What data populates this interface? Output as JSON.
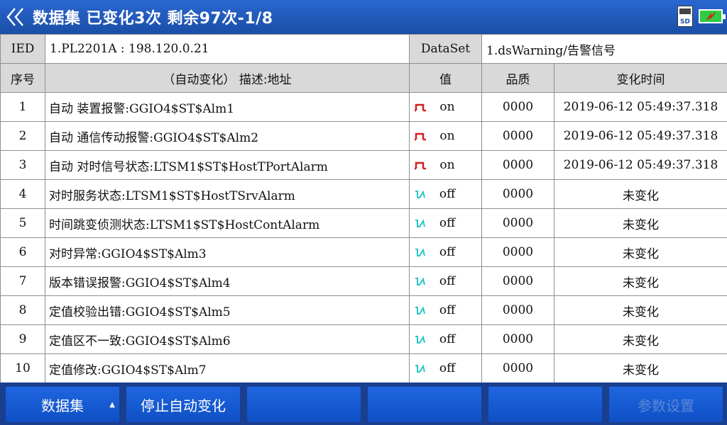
{
  "header": {
    "title": "数据集  已变化3次  剩余97次-1/8",
    "back_icon": "double-chevron-left-icon",
    "sd_label": "SD",
    "battery_color": "#2ecc40"
  },
  "info": {
    "ied_label": "IED",
    "ied_value": "1.PL2201A : 198.120.0.21",
    "dataset_label": "DataSet",
    "dataset_value": "1.dsWarning/告警信号"
  },
  "columns": {
    "index": "序号",
    "desc": "（自动变化） 描述:地址",
    "value": "值",
    "quality": "品质",
    "time": "变化时间"
  },
  "rows": [
    {
      "index": "1",
      "desc": "自动 装置报警:GGIO4$ST$Alm1",
      "state": "on",
      "value": "on",
      "quality": "0000",
      "time": "2019-06-12 05:49:37.318"
    },
    {
      "index": "2",
      "desc": "自动 通信传动报警:GGIO4$ST$Alm2",
      "state": "on",
      "value": "on",
      "quality": "0000",
      "time": "2019-06-12 05:49:37.318"
    },
    {
      "index": "3",
      "desc": "自动 对时信号状态:LTSM1$ST$HostTPortAlarm",
      "state": "on",
      "value": "on",
      "quality": "0000",
      "time": "2019-06-12 05:49:37.318"
    },
    {
      "index": "4",
      "desc": "对时服务状态:LTSM1$ST$HostTSrvAlarm",
      "state": "off",
      "value": "off",
      "quality": "0000",
      "time": "未变化"
    },
    {
      "index": "5",
      "desc": "时间跳变侦测状态:LTSM1$ST$HostContAlarm",
      "state": "off",
      "value": "off",
      "quality": "0000",
      "time": "未变化"
    },
    {
      "index": "6",
      "desc": "对时异常:GGIO4$ST$Alm3",
      "state": "off",
      "value": "off",
      "quality": "0000",
      "time": "未变化"
    },
    {
      "index": "7",
      "desc": "版本错误报警:GGIO4$ST$Alm4",
      "state": "off",
      "value": "off",
      "quality": "0000",
      "time": "未变化"
    },
    {
      "index": "8",
      "desc": "定值校验出错:GGIO4$ST$Alm5",
      "state": "off",
      "value": "off",
      "quality": "0000",
      "time": "未变化"
    },
    {
      "index": "9",
      "desc": "定值区不一致:GGIO4$ST$Alm6",
      "state": "off",
      "value": "off",
      "quality": "0000",
      "time": "未变化"
    },
    {
      "index": "10",
      "desc": "定值修改:GGIO4$ST$Alm7",
      "state": "off",
      "value": "off",
      "quality": "0000",
      "time": "未变化"
    }
  ],
  "colors": {
    "on_wave": "#d42020",
    "off_wave": "#27c6c6"
  },
  "footer": {
    "btn1": "数据集",
    "btn2": "停止自动变化",
    "btn3": "",
    "btn4": "",
    "btn5": "",
    "btn6": "参数设置"
  }
}
